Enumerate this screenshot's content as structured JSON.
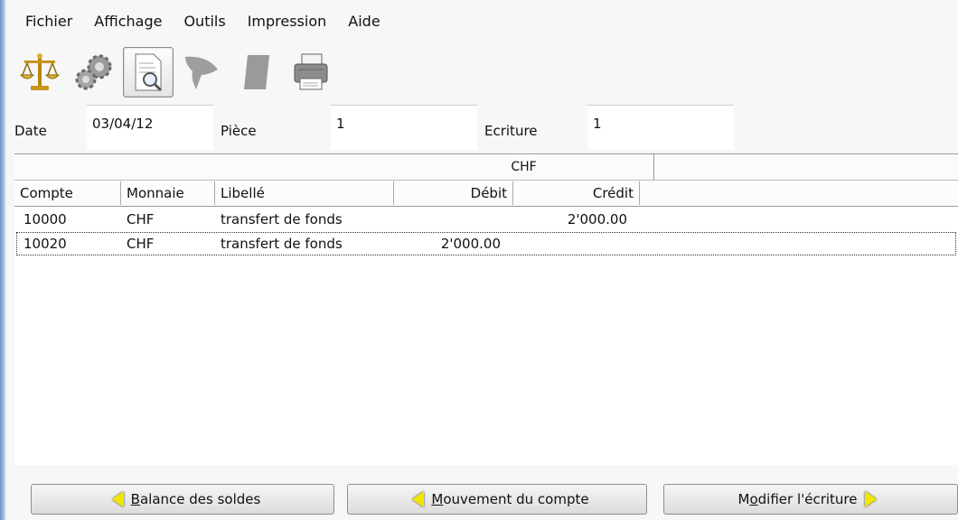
{
  "menu": [
    "Fichier",
    "Affichage",
    "Outils",
    "Impression",
    "Aide"
  ],
  "toolbar": {
    "icons": [
      "balance-icon",
      "gears-icon",
      "document-search-icon",
      "funnel-icon",
      "book-icon",
      "printer-icon"
    ]
  },
  "fields": {
    "date_label": "Date",
    "date_value": "03/04/12",
    "piece_label": "Pièce",
    "piece_value": "1",
    "ecriture_label": "Ecriture",
    "ecriture_value": "1"
  },
  "grid": {
    "currency_band": "CHF",
    "columns": [
      "Compte",
      "Monnaie",
      "Libellé",
      "Débit",
      "Crédit"
    ],
    "rows": [
      {
        "compte": "10000",
        "monnaie": "CHF",
        "libelle": "transfert de fonds",
        "debit": "",
        "credit": "2'000.00"
      },
      {
        "compte": "10020",
        "monnaie": "CHF",
        "libelle": "transfert de fonds",
        "debit": "2'000.00",
        "credit": ""
      }
    ]
  },
  "buttons": {
    "balance": {
      "mnemonic": "B",
      "rest": "alance des soldes"
    },
    "mouvement": {
      "mnemonic": "M",
      "rest": "ouvement du compte"
    },
    "modifier": {
      "pre": "M",
      "mnemonic": "o",
      "rest": "difier l'écriture"
    }
  },
  "colors": {
    "arrow": "#f2e600",
    "accent_edge": "#6f8fc6"
  }
}
